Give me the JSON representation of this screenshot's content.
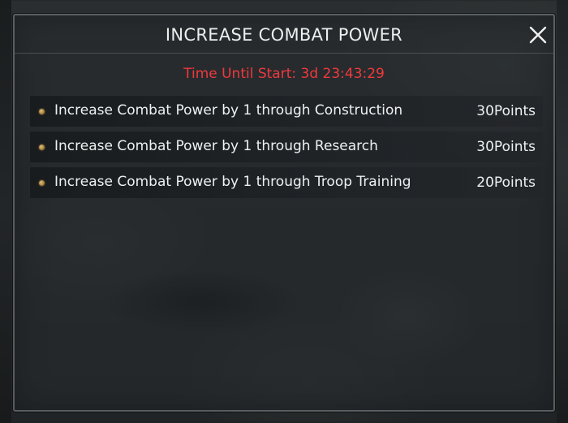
{
  "dialog": {
    "title": "INCREASE COMBAT POWER",
    "close_icon": "close-icon",
    "timer_text": "Time Until Start: 3d 23:43:29",
    "timer_color": "#f0393c"
  },
  "tasks": [
    {
      "label": "Increase Combat Power by 1 through Construction",
      "points": "30Points",
      "icon": "bullet-icon"
    },
    {
      "label": "Increase Combat Power by 1 through Research",
      "points": "30Points",
      "icon": "bullet-icon"
    },
    {
      "label": "Increase Combat Power by 1 through Troop Training",
      "points": "20Points",
      "icon": "bullet-icon"
    }
  ]
}
